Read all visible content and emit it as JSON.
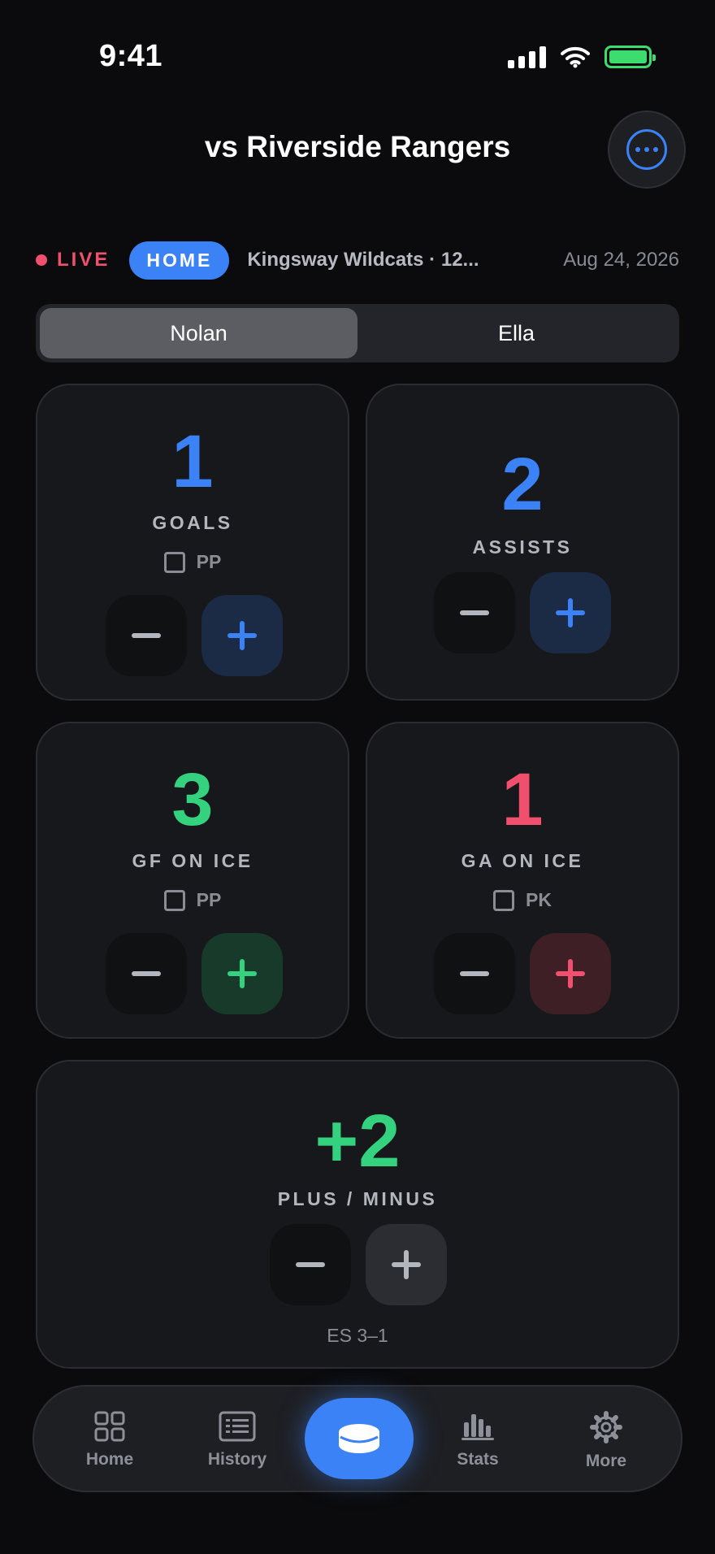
{
  "status_bar": {
    "time": "9:41",
    "icons": [
      "signal-icon",
      "wifi-icon",
      "battery-charging-icon"
    ]
  },
  "header": {
    "title": "vs Riverside Rangers",
    "more_icon": "ellipsis-circle-icon"
  },
  "game_info": {
    "live_label": "LIVE",
    "home_away": "HOME",
    "team": "Kingsway Wildcats · 12...",
    "date": "Aug 24, 2026"
  },
  "players": {
    "tabs": [
      "Nolan",
      "Ella"
    ],
    "selected": "Nolan"
  },
  "stats": {
    "goals": {
      "value": "1",
      "label": "GOALS",
      "checkbox_label": "PP",
      "checked": false
    },
    "assists": {
      "value": "2",
      "label": "ASSISTS"
    },
    "gf_on_ice": {
      "value": "3",
      "label": "GF ON ICE",
      "checkbox_label": "PP",
      "checked": false
    },
    "ga_on_ice": {
      "value": "1",
      "label": "GA ON ICE",
      "checkbox_label": "PK",
      "checked": false
    },
    "plus_minus": {
      "value": "+2",
      "label": "PLUS / MINUS",
      "footer": "ES 3–1"
    }
  },
  "colors": {
    "blue": "#3b82f6",
    "green": "#34d17f",
    "red": "#f0506e"
  },
  "tabbar": {
    "home": "Home",
    "history": "History",
    "center_icon": "hockey-puck-icon",
    "stats": "Stats",
    "more": "More"
  }
}
